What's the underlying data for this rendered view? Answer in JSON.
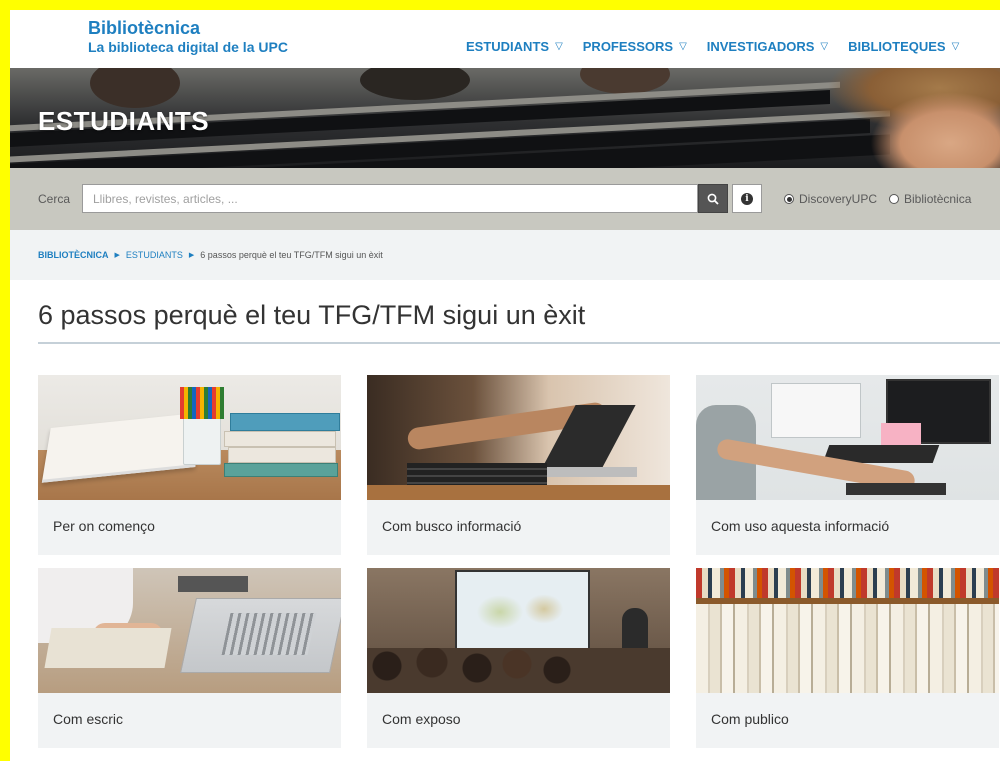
{
  "header": {
    "brand_name": "Bibliotècnica",
    "brand_sub": "La biblioteca digital de la UPC",
    "nav": [
      "ESTUDIANTS",
      "PROFESSORS",
      "INVESTIGADORS",
      "BIBLIOTEQUES"
    ],
    "nav_caret_icon": "triangle-down-icon"
  },
  "hero": {
    "title": "ESTUDIANTS"
  },
  "search": {
    "label": "Cerca",
    "placeholder": "Llibres, revistes, articles, ...",
    "options": [
      "DiscoveryUPC",
      "Bibliotècnica"
    ],
    "selected": "DiscoveryUPC"
  },
  "breadcrumb": {
    "home": "BIBLIOTÈCNICA",
    "section": "ESTUDIANTS",
    "current": "6 passos perquè el teu TFG/TFM sigui un èxit"
  },
  "page": {
    "title": "6 passos perquè el teu TFG/TFM sigui un èxit"
  },
  "cards": [
    {
      "label": "Per on començo"
    },
    {
      "label": "Com busco informació"
    },
    {
      "label": "Com uso aquesta informació"
    },
    {
      "label": "Com escric"
    },
    {
      "label": "Com exposo"
    },
    {
      "label": "Com publico"
    }
  ],
  "colors": {
    "accent": "#1e7fc0",
    "frame": "#ffff00",
    "card_bg": "#f1f3f4"
  }
}
